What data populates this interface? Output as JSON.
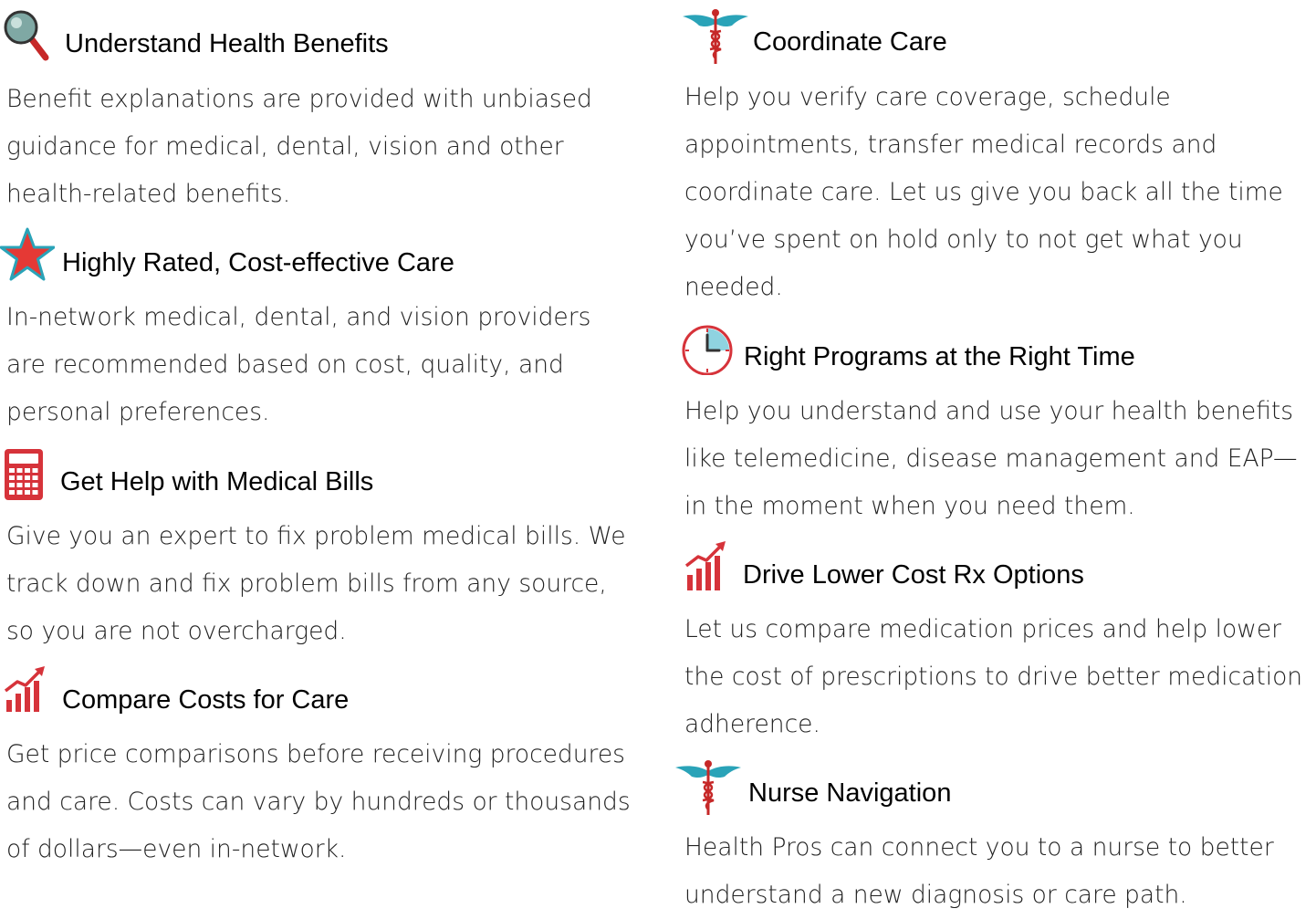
{
  "left_column": [
    {
      "icon": "magnifier-icon",
      "title": "Understand Health Benefits",
      "body": "Benefit explanations are provided with unbiased guidance for medical, dental, vision and other health-related benefits."
    },
    {
      "icon": "star-icon",
      "title": "Highly Rated, Cost-effective Care",
      "body": "In-network medical, dental, and vision providers are recommended based on cost, quality, and personal preferences."
    },
    {
      "icon": "calculator-icon",
      "title": "Get Help with Medical Bills",
      "body": "Give you an expert to fix problem medical bills. We track down and fix problem bills from any source, so you are not overcharged."
    },
    {
      "icon": "rising-chart-icon",
      "title": "Compare Costs for Care",
      "body": "Get price comparisons before receiving procedures and care. Costs can vary by hundreds or thousands of dollars—even in-network."
    }
  ],
  "right_column": [
    {
      "icon": "caduceus-icon",
      "title": "Coordinate Care",
      "body": "Help you verify care coverage, schedule appointments, transfer medical records and coordinate care. Let us give you back all the time you’ve spent on hold only to not get what you needed."
    },
    {
      "icon": "clock-icon",
      "title": "Right Programs at the Right Time",
      "body": "Help you understand and use your health benefits like telemedicine, disease management and EAP—in the moment when you need them."
    },
    {
      "icon": "rising-chart-icon",
      "title": "Drive Lower Cost Rx Options",
      "body": "Let us compare medication prices and help lower the cost of prescriptions to drive better medication adherence."
    },
    {
      "icon": "caduceus-icon",
      "title": "Nurse Navigation",
      "body": "Health Pros can connect you to a nurse to better understand a new diagnosis or care path."
    }
  ],
  "colors": {
    "icon_red": "#d6333a",
    "icon_teal": "#2aa3b8",
    "title_text": "#000000",
    "body_text": "#222222"
  }
}
